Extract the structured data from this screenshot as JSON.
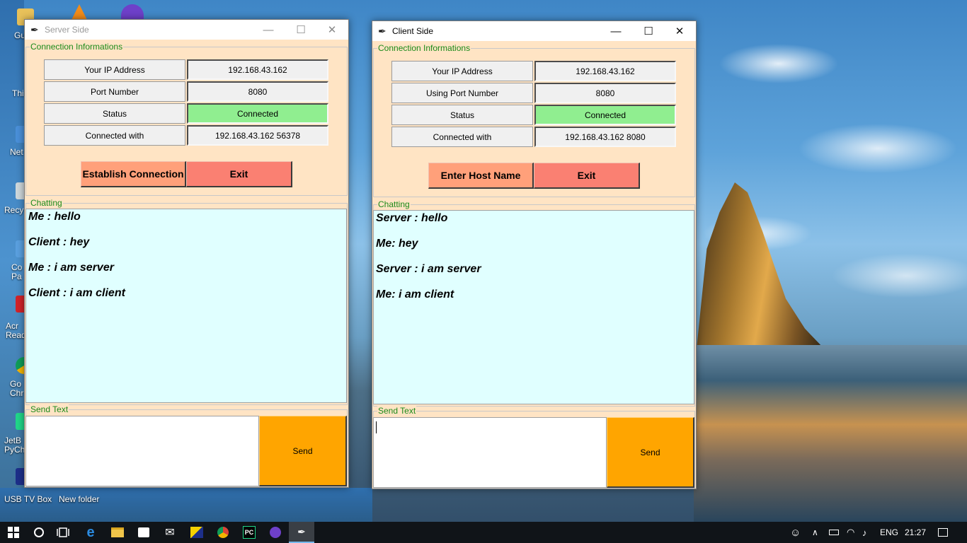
{
  "desktop": {
    "icon_labels": [
      "Gu",
      "Thi",
      "Net",
      "Recy",
      "Co Pa",
      "Acr Read",
      "Go Chr",
      "JetB PyCh",
      "USB TV Box",
      "New folder"
    ]
  },
  "server_window": {
    "title": "Server Side",
    "conn_frame_label": "Connection Informations",
    "rows": [
      {
        "label": "Your IP Address",
        "value": "192.168.43.162"
      },
      {
        "label": "Port Number",
        "value": "8080"
      },
      {
        "label": "Status",
        "value": "Connected"
      },
      {
        "label": "Connected with",
        "value": "192.168.43.162 56378"
      }
    ],
    "primary_button": "Establish Connection",
    "exit_button": "Exit",
    "chat_frame_label": "Chatting",
    "messages": [
      "Me : hello",
      "Client : hey",
      "Me : i am server",
      "Client : i am client"
    ],
    "send_frame_label": "Send Text",
    "input_value": "",
    "send_button": "Send"
  },
  "client_window": {
    "title": "Client Side",
    "conn_frame_label": "Connection Informations",
    "rows": [
      {
        "label": "Your IP Address",
        "value": "192.168.43.162"
      },
      {
        "label": "Using Port Number",
        "value": "8080"
      },
      {
        "label": "Status",
        "value": "Connected"
      },
      {
        "label": "Connected with",
        "value": "192.168.43.162 8080"
      }
    ],
    "primary_button": "Enter Host Name",
    "exit_button": "Exit",
    "chat_frame_label": "Chatting",
    "messages": [
      "Server : hello",
      "Me: hey",
      "Server : i am server",
      "Me: i am client"
    ],
    "send_frame_label": "Send Text",
    "input_value": "",
    "send_button": "Send"
  },
  "colors": {
    "window_bg": "#ffe4c4",
    "status_connected": "#90ee90",
    "chat_bg": "#e0ffff",
    "send_button": "#ffa500",
    "primary_button": "#ffa07a",
    "exit_button": "#fa8072",
    "frame_label": "#1a8a1a"
  },
  "taskbar": {
    "apps": [
      "start-icon",
      "search-icon",
      "task-view-icon",
      "edge-icon",
      "file-explorer-icon",
      "store-icon",
      "mail-icon",
      "tv-icon",
      "chrome-icon",
      "pycharm-icon",
      "github-icon",
      "python-feather-icon"
    ],
    "language": "ENG",
    "time": "21:27"
  }
}
